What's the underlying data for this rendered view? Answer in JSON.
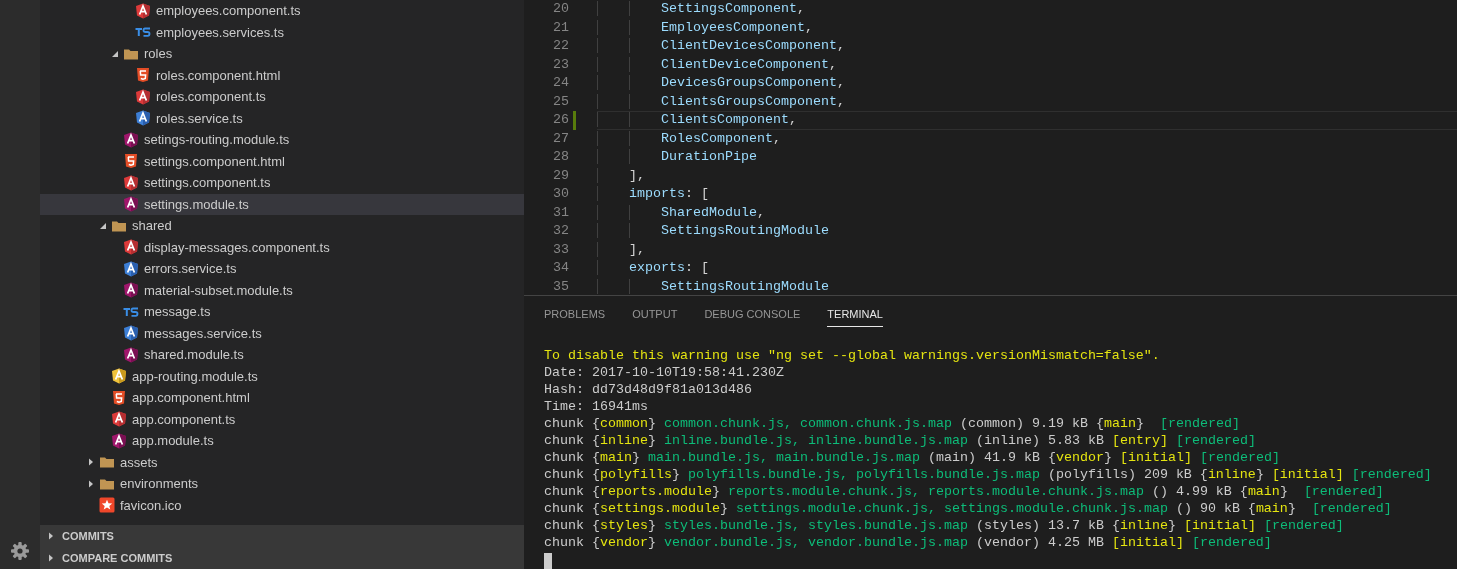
{
  "explorer": {
    "tree": [
      {
        "children": [
          {
            "children": [
              {
                "children": [
                  {
                    "name": "employees.component.ts",
                    "kind": "component",
                    "selected": false
                  },
                  {
                    "name": "employees.services.ts",
                    "kind": "typescript",
                    "selected": false
                  }
                ]
              },
              {
                "name": "roles",
                "kind": "folder",
                "expanded": true,
                "children": [
                  {
                    "name": "roles.component.html",
                    "kind": "html",
                    "selected": false
                  },
                  {
                    "name": "roles.component.ts",
                    "kind": "component",
                    "selected": false
                  },
                  {
                    "name": "roles.service.ts",
                    "kind": "service",
                    "selected": false
                  }
                ]
              },
              {
                "name": "setings-routing.module.ts",
                "kind": "module",
                "selected": false
              },
              {
                "name": "settings.component.html",
                "kind": "html",
                "selected": false
              },
              {
                "name": "settings.component.ts",
                "kind": "component",
                "selected": false
              },
              {
                "name": "settings.module.ts",
                "kind": "module",
                "selected": true
              }
            ]
          },
          {
            "name": "shared",
            "kind": "folder",
            "expanded": true,
            "children": [
              {
                "name": "display-messages.component.ts",
                "kind": "component",
                "selected": false
              },
              {
                "name": "errors.service.ts",
                "kind": "service",
                "selected": false
              },
              {
                "name": "material-subset.module.ts",
                "kind": "module",
                "selected": false
              },
              {
                "name": "message.ts",
                "kind": "typescript",
                "selected": false
              },
              {
                "name": "messages.service.ts",
                "kind": "service",
                "selected": false
              },
              {
                "name": "shared.module.ts",
                "kind": "module",
                "selected": false
              }
            ]
          },
          {
            "name": "app-routing.module.ts",
            "kind": "routing",
            "selected": false
          },
          {
            "name": "app.component.html",
            "kind": "html",
            "selected": false
          },
          {
            "name": "app.component.ts",
            "kind": "component",
            "selected": false
          },
          {
            "name": "app.module.ts",
            "kind": "module",
            "selected": false
          }
        ]
      },
      {
        "name": "assets",
        "kind": "folder",
        "expanded": false
      },
      {
        "name": "environments",
        "kind": "folder",
        "expanded": false
      },
      {
        "name": "favicon.ico",
        "kind": "star",
        "selected": false
      }
    ]
  },
  "sections": [
    {
      "label": "COMMITS",
      "expanded": false
    },
    {
      "label": "COMPARE COMMITS",
      "expanded": false
    }
  ],
  "editor": {
    "lines": [
      {
        "number": "20",
        "text": "        SettingsComponent,",
        "current": false,
        "modified": false
      },
      {
        "number": "21",
        "text": "        EmployeesComponent,",
        "current": false,
        "modified": false
      },
      {
        "number": "22",
        "text": "        ClientDevicesComponent,",
        "current": false,
        "modified": false
      },
      {
        "number": "23",
        "text": "        ClientDeviceComponent,",
        "current": false,
        "modified": false
      },
      {
        "number": "24",
        "text": "        DevicesGroupsComponent,",
        "current": false,
        "modified": false
      },
      {
        "number": "25",
        "text": "        ClientsGroupsComponent,",
        "current": false,
        "modified": false
      },
      {
        "number": "26",
        "text": "        ClientsComponent,",
        "current": true,
        "modified": true
      },
      {
        "number": "27",
        "text": "        RolesComponent,",
        "current": false,
        "modified": false
      },
      {
        "number": "28",
        "text": "        DurationPipe",
        "current": false,
        "modified": false
      },
      {
        "number": "29",
        "text": "    ],",
        "current": false,
        "modified": false
      },
      {
        "number": "30",
        "text": "    imports: [",
        "current": false,
        "modified": false
      },
      {
        "number": "31",
        "text": "        SharedModule,",
        "current": false,
        "modified": false
      },
      {
        "number": "32",
        "text": "        SettingsRoutingModule",
        "current": false,
        "modified": false
      },
      {
        "number": "33",
        "text": "    ],",
        "current": false,
        "modified": false
      },
      {
        "number": "34",
        "text": "    exports: [",
        "current": false,
        "modified": false
      },
      {
        "number": "35",
        "text": "        SettingsRoutingModule",
        "current": false,
        "modified": false
      }
    ]
  },
  "panel": {
    "tabs": [
      {
        "label": "PROBLEMS",
        "selected": false
      },
      {
        "label": "OUTPUT",
        "selected": false
      },
      {
        "label": "DEBUG CONSOLE",
        "selected": false
      },
      {
        "label": "TERMINAL",
        "selected": true
      }
    ],
    "terminal": [
      [
        {
          "text": "To disable this warning use \"ng set --global warnings.versionMismatch=false\".",
          "kind": "yellow"
        }
      ],
      [
        {
          "text": "Date: 2017-10-10T19:58:41.230Z",
          "kind": "plain"
        }
      ],
      [
        {
          "text": "Hash: dd73d48d9f81a013d486",
          "kind": "plain"
        }
      ],
      [
        {
          "text": "Time: 16941ms",
          "kind": "plain"
        }
      ],
      [
        {
          "text": "chunk {",
          "kind": "plain"
        },
        {
          "text": "common",
          "kind": "yellow"
        },
        {
          "text": "} ",
          "kind": "plain"
        },
        {
          "text": "common.chunk.js, common.chunk.js.map",
          "kind": "green"
        },
        {
          "text": " (common) 9.19 kB {",
          "kind": "plain"
        },
        {
          "text": "main",
          "kind": "yellow"
        },
        {
          "text": "}  ",
          "kind": "plain"
        },
        {
          "text": "[rendered]",
          "kind": "green"
        }
      ],
      [
        {
          "text": "chunk {",
          "kind": "plain"
        },
        {
          "text": "inline",
          "kind": "yellow"
        },
        {
          "text": "} ",
          "kind": "plain"
        },
        {
          "text": "inline.bundle.js, inline.bundle.js.map",
          "kind": "green"
        },
        {
          "text": " (inline) 5.83 kB ",
          "kind": "plain"
        },
        {
          "text": "[entry]",
          "kind": "yellow"
        },
        {
          "text": " [rendered]",
          "kind": "green"
        }
      ],
      [
        {
          "text": "chunk {",
          "kind": "plain"
        },
        {
          "text": "main",
          "kind": "yellow"
        },
        {
          "text": "} ",
          "kind": "plain"
        },
        {
          "text": "main.bundle.js, main.bundle.js.map",
          "kind": "green"
        },
        {
          "text": " (main) 41.9 kB {",
          "kind": "plain"
        },
        {
          "text": "vendor",
          "kind": "yellow"
        },
        {
          "text": "} ",
          "kind": "plain"
        },
        {
          "text": "[initial]",
          "kind": "yellow"
        },
        {
          "text": " [rendered]",
          "kind": "green"
        }
      ],
      [
        {
          "text": "chunk {",
          "kind": "plain"
        },
        {
          "text": "polyfills",
          "kind": "yellow"
        },
        {
          "text": "} ",
          "kind": "plain"
        },
        {
          "text": "polyfills.bundle.js, polyfills.bundle.js.map",
          "kind": "green"
        },
        {
          "text": " (polyfills) 209 kB {",
          "kind": "plain"
        },
        {
          "text": "inline",
          "kind": "yellow"
        },
        {
          "text": "} ",
          "kind": "plain"
        },
        {
          "text": "[initial]",
          "kind": "yellow"
        },
        {
          "text": " [rendered]",
          "kind": "green"
        }
      ],
      [
        {
          "text": "chunk {",
          "kind": "plain"
        },
        {
          "text": "reports.module",
          "kind": "yellow"
        },
        {
          "text": "} ",
          "kind": "plain"
        },
        {
          "text": "reports.module.chunk.js, reports.module.chunk.js.map",
          "kind": "green"
        },
        {
          "text": " () 4.99 kB {",
          "kind": "plain"
        },
        {
          "text": "main",
          "kind": "yellow"
        },
        {
          "text": "}  ",
          "kind": "plain"
        },
        {
          "text": "[rendered]",
          "kind": "green"
        }
      ],
      [
        {
          "text": "chunk {",
          "kind": "plain"
        },
        {
          "text": "settings.module",
          "kind": "yellow"
        },
        {
          "text": "} ",
          "kind": "plain"
        },
        {
          "text": "settings.module.chunk.js, settings.module.chunk.js.map",
          "kind": "green"
        },
        {
          "text": " () 90 kB {",
          "kind": "plain"
        },
        {
          "text": "main",
          "kind": "yellow"
        },
        {
          "text": "}  ",
          "kind": "plain"
        },
        {
          "text": "[rendered]",
          "kind": "green"
        }
      ],
      [
        {
          "text": "chunk {",
          "kind": "plain"
        },
        {
          "text": "styles",
          "kind": "yellow"
        },
        {
          "text": "} ",
          "kind": "plain"
        },
        {
          "text": "styles.bundle.js, styles.bundle.js.map",
          "kind": "green"
        },
        {
          "text": " (styles) 13.7 kB {",
          "kind": "plain"
        },
        {
          "text": "inline",
          "kind": "yellow"
        },
        {
          "text": "} ",
          "kind": "plain"
        },
        {
          "text": "[initial]",
          "kind": "yellow"
        },
        {
          "text": " [rendered]",
          "kind": "green"
        }
      ],
      [
        {
          "text": "chunk {",
          "kind": "plain"
        },
        {
          "text": "vendor",
          "kind": "yellow"
        },
        {
          "text": "} ",
          "kind": "plain"
        },
        {
          "text": "vendor.bundle.js, vendor.bundle.js.map",
          "kind": "green"
        },
        {
          "text": " (vendor) 4.25 MB ",
          "kind": "plain"
        },
        {
          "text": "[initial]",
          "kind": "yellow"
        },
        {
          "text": " [rendered]",
          "kind": "green"
        }
      ]
    ]
  }
}
